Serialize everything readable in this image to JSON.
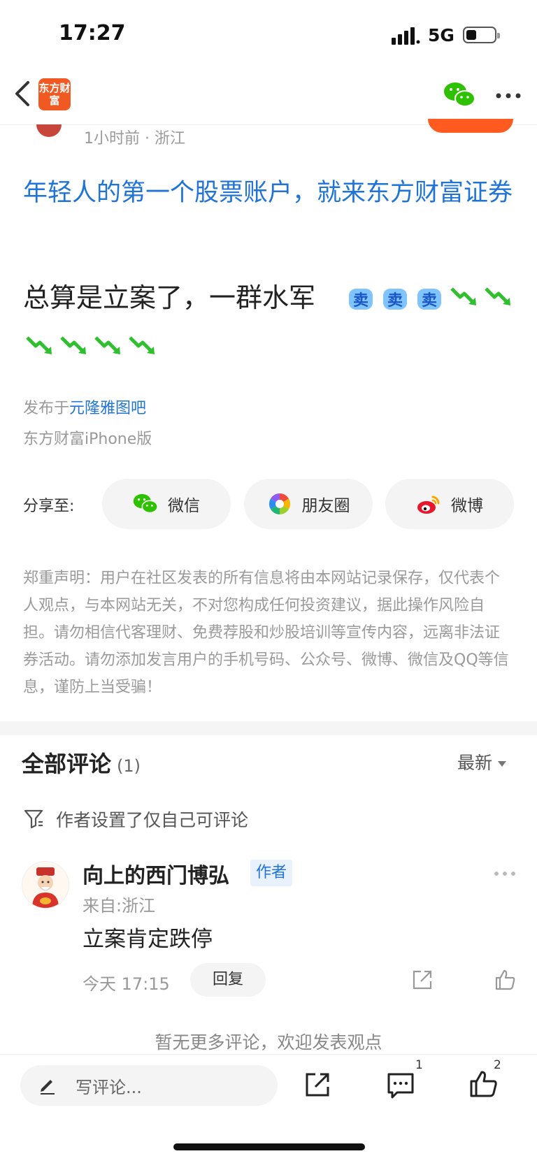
{
  "status_bar": {
    "time": "17:27",
    "network": "5G"
  },
  "header": {
    "logo_text": "东方财富"
  },
  "post_meta": "1小时前 · 浙江",
  "promo": "年轻人的第一个股票账户，就来东方财富证券",
  "post": {
    "text": "总算是立案了，一群水军",
    "emoji_sell_label": "卖"
  },
  "posted_in_prefix": "发布于",
  "forum_name": "元隆雅图吧",
  "client": "东方财富iPhone版",
  "share": {
    "label": "分享至:",
    "wechat": "微信",
    "moments": "朋友圈",
    "weibo": "微博"
  },
  "disclaimer": "郑重声明：用户在社区发表的所有信息将由本网站记录保存，仅代表个人观点，与本网站无关，不对您构成任何投资建议，据此操作风险自担。请勿相信代客理财、免费荐股和炒股培训等宣传内容，远离非法证券活动。请勿添加发言用户的手机号码、公众号、微博、微信及QQ等信息，谨防上当受骗！",
  "comments": {
    "title": "全部评论",
    "count": "(1)",
    "sort": "最新",
    "restriction": "作者设置了仅自己可评论",
    "items": [
      {
        "name": "向上的西门博弘",
        "tag": "作者",
        "from": "来自:浙江",
        "text": "立案肯定跌停",
        "time": "今天 17:15",
        "reply": "回复"
      }
    ],
    "no_more": "暂无更多评论，欢迎发表观点"
  },
  "bottom_bar": {
    "placeholder": "写评论...",
    "comment_count": "1",
    "like_count": "2"
  },
  "colors": {
    "link_blue": "#1f74d6",
    "brand_orange": "#f05a22",
    "wechat_green": "#2ec100",
    "down_arrow_green": "#2fbf2f"
  }
}
